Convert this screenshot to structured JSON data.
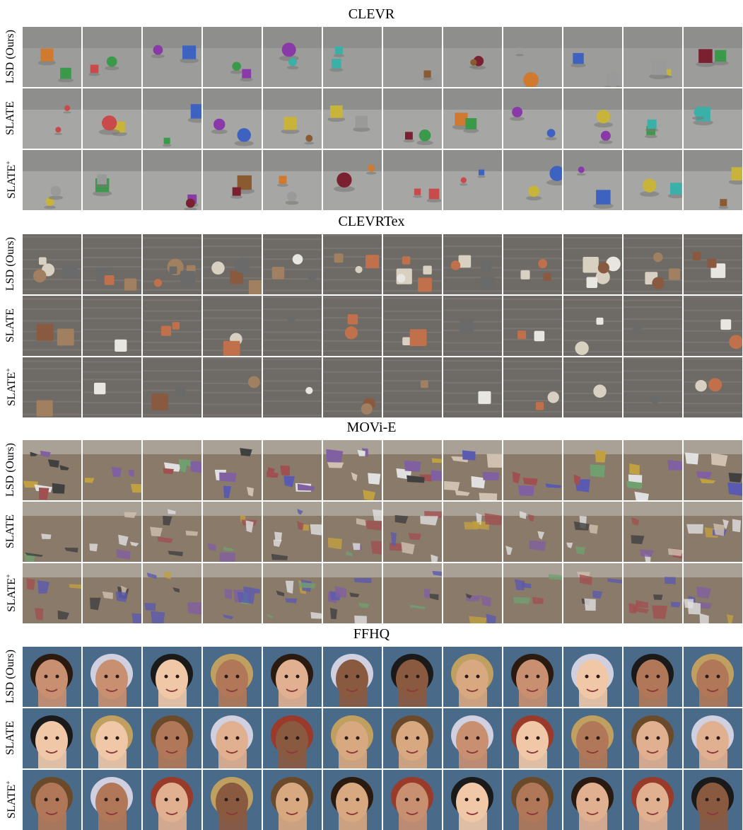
{
  "sections": [
    {
      "title": "CLEVR",
      "kind": "clevr",
      "rows": [
        {
          "label": "LSD (Ours)",
          "sup": ""
        },
        {
          "label": "SLATE",
          "sup": ""
        },
        {
          "label": "SLATE",
          "sup": "+"
        }
      ]
    },
    {
      "title": "CLEVRTex",
      "kind": "clevrtex",
      "rows": [
        {
          "label": "LSD (Ours)",
          "sup": ""
        },
        {
          "label": "SLATE",
          "sup": ""
        },
        {
          "label": "SLATE",
          "sup": "+"
        }
      ]
    },
    {
      "title": "MOVi-E",
      "kind": "movi",
      "rows": [
        {
          "label": "LSD (Ours)",
          "sup": ""
        },
        {
          "label": "SLATE",
          "sup": ""
        },
        {
          "label": "SLATE",
          "sup": "+"
        }
      ]
    },
    {
      "title": "FFHQ",
      "kind": "ffhq",
      "rows": [
        {
          "label": "LSD (Ours)",
          "sup": ""
        },
        {
          "label": "SLATE",
          "sup": ""
        },
        {
          "label": "SLATE",
          "sup": "+"
        }
      ]
    }
  ],
  "images_per_row": 12
}
